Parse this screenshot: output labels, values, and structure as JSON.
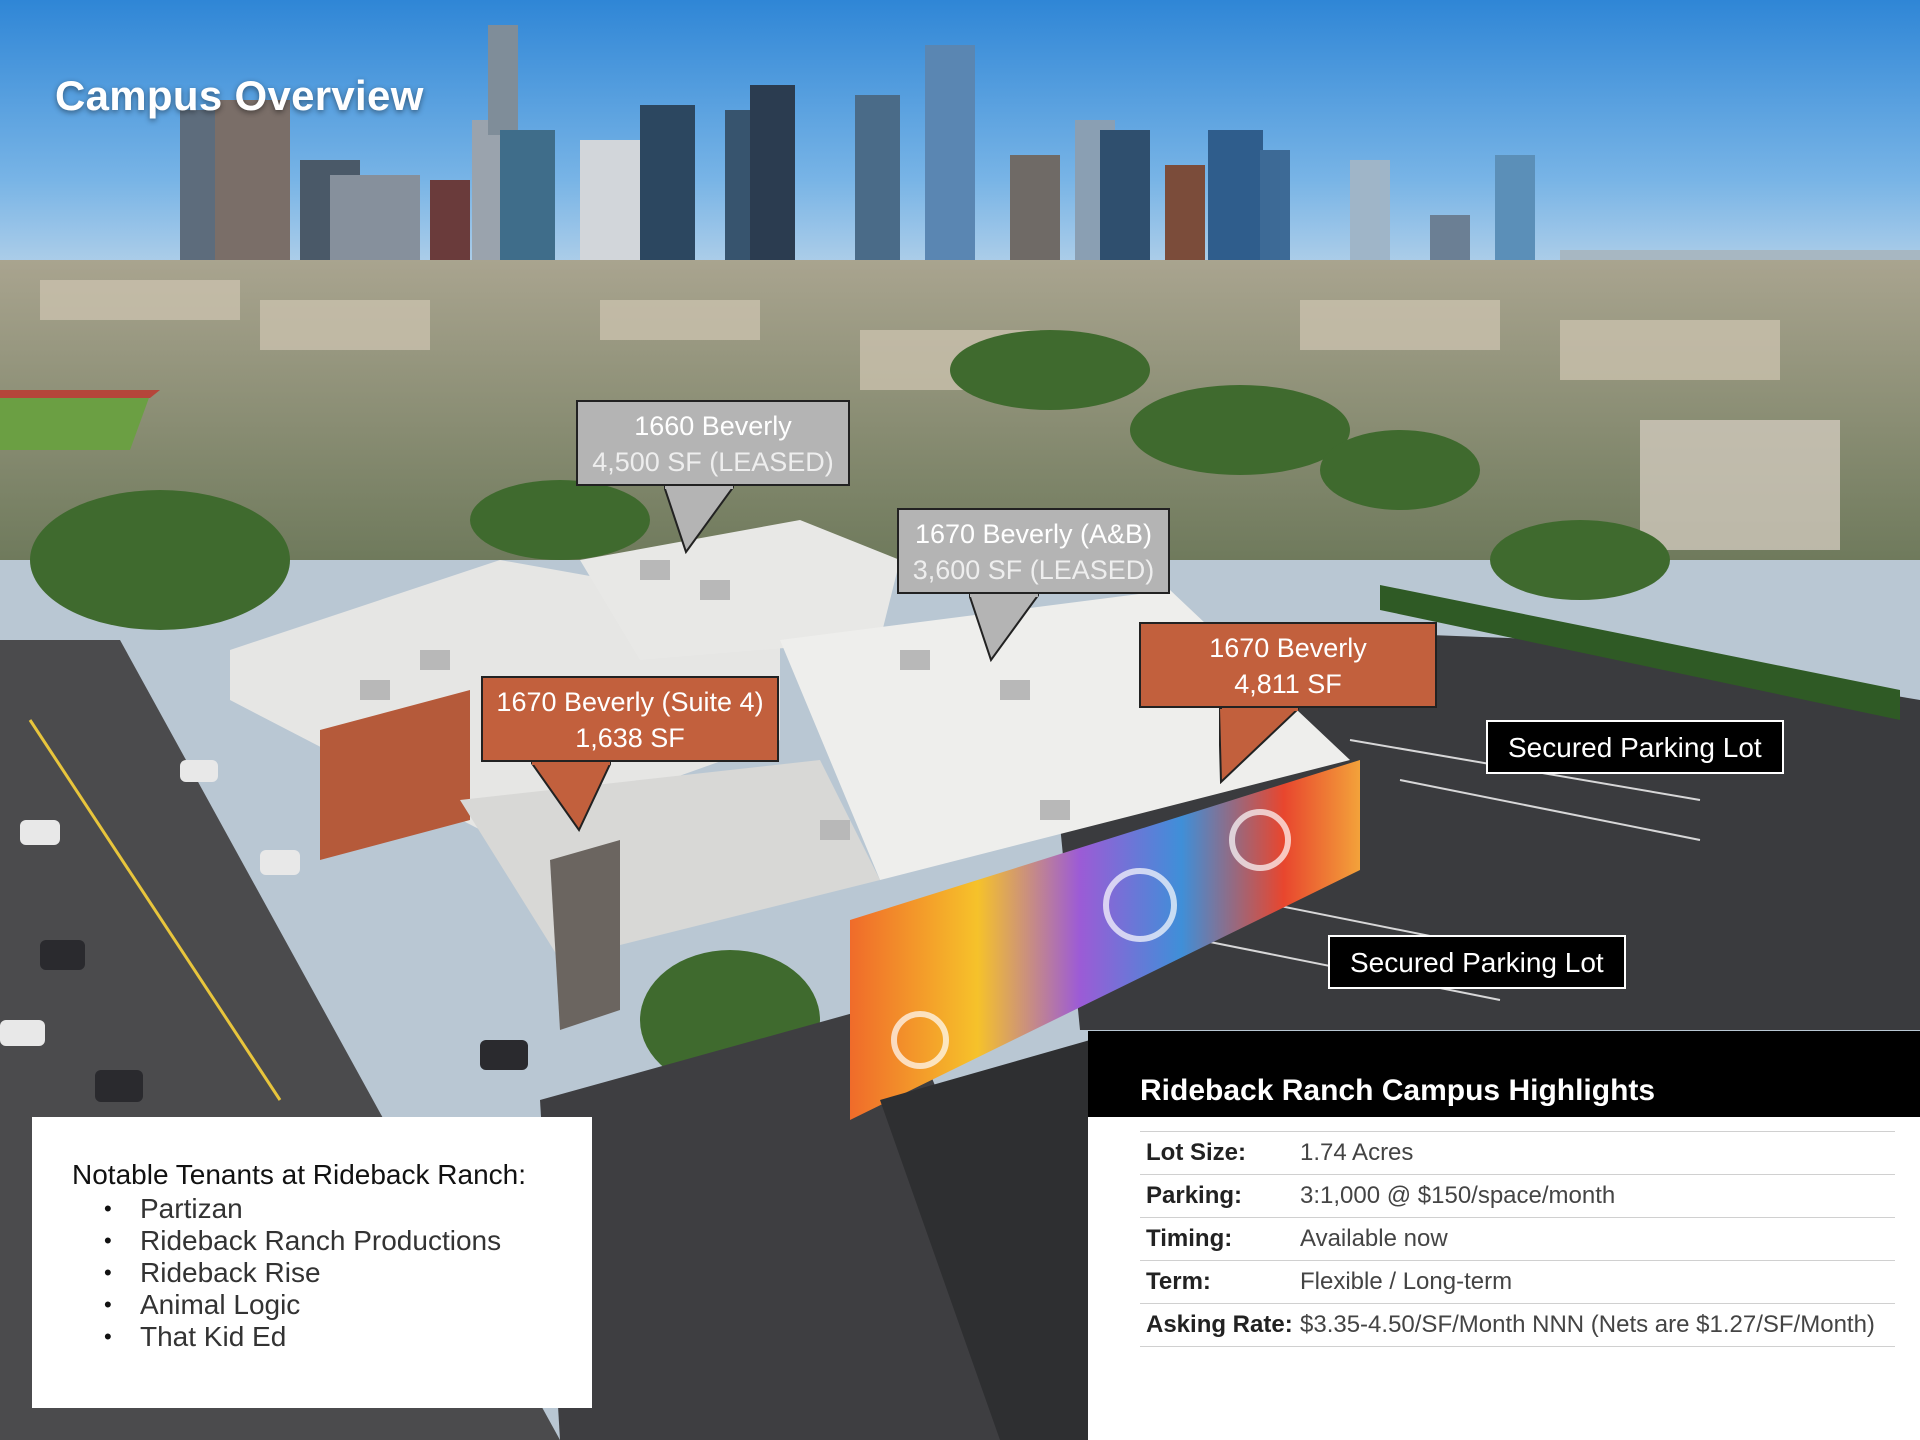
{
  "title": "Campus Overview",
  "callouts": {
    "b1660": {
      "name": "1660 Beverly",
      "detail": "4,500 SF (LEASED)"
    },
    "b1670ab": {
      "name": "1670 Beverly (A&B)",
      "detail": "3,600 SF (LEASED)"
    },
    "b1670": {
      "name": "1670 Beverly",
      "detail": "4,811 SF"
    },
    "b1670s4": {
      "name": "1670 Beverly (Suite 4)",
      "detail": "1,638 SF"
    }
  },
  "parking": {
    "upper": "Secured Parking Lot",
    "lower": "Secured Parking Lot"
  },
  "tenants": {
    "heading": "Notable Tenants at Rideback Ranch:",
    "items": [
      "Partizan",
      "Rideback Ranch Productions",
      "Rideback Rise",
      "Animal Logic",
      "That Kid Ed"
    ],
    "bullet": "•"
  },
  "highlights": {
    "title": "Rideback Ranch Campus Highlights",
    "rows": [
      {
        "label": "Lot Size:",
        "value": "1.74 Acres"
      },
      {
        "label": "Parking:",
        "value": "3:1,000 @ $150/space/month"
      },
      {
        "label": "Timing:",
        "value": "Available now"
      },
      {
        "label": "Term:",
        "value": "Flexible / Long-term"
      },
      {
        "label": "Asking Rate:",
        "value": "$3.35-4.50/SF/Month NNN (Nets are $1.27/SF/Month)"
      }
    ]
  },
  "colors": {
    "leased_callout": "#b4b4b4",
    "available_callout": "#c2603d",
    "label_black": "#000000"
  }
}
